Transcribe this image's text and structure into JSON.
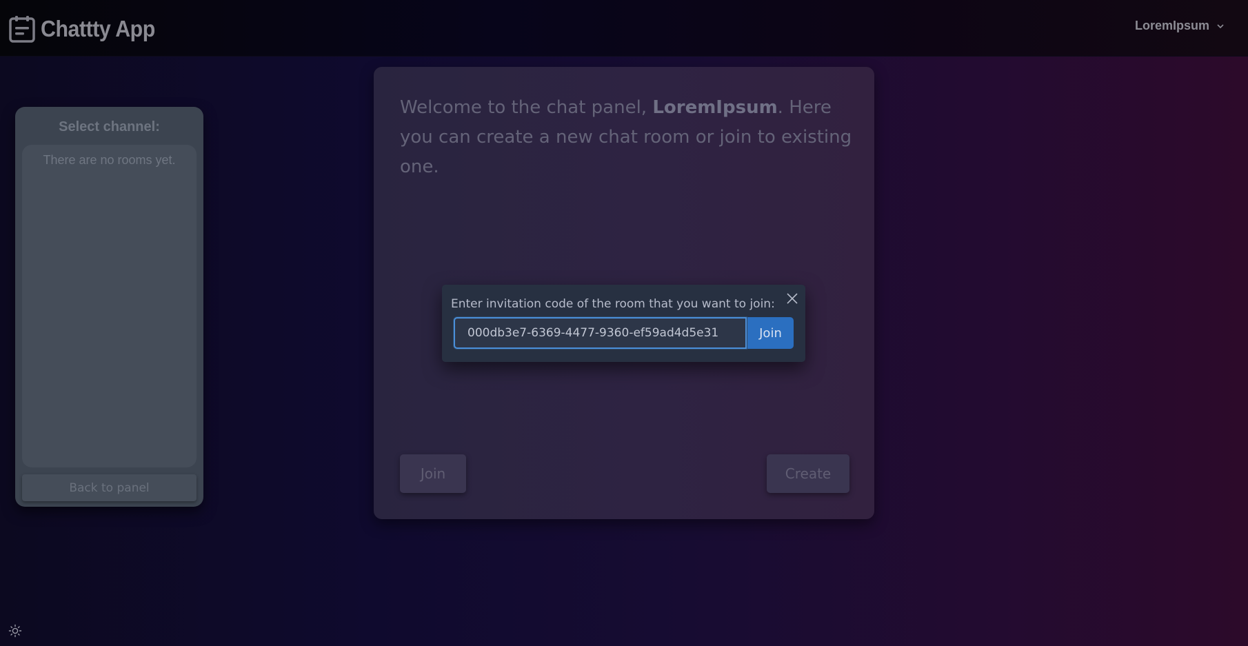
{
  "navbar": {
    "app_title": "Chattty App",
    "user_name": "LoremIpsum"
  },
  "sidebar": {
    "title": "Select channel:",
    "empty_text": "There are no rooms yet.",
    "back_label": "Back to panel"
  },
  "panel": {
    "welcome_prefix": "Welcome to the chat panel, ",
    "welcome_user": "LoremIpsum",
    "welcome_suffix": ". Here you can create a new chat room or join to existing one.",
    "join_label": "Join",
    "create_label": "Create"
  },
  "modal": {
    "label": "Enter invitation code of the room that you want to join:",
    "code_value": "000db3e7-6369-4477-9360-ef59ad4d5e31",
    "join_label": "Join"
  },
  "icons": {
    "brand": "calendar-note-icon",
    "user_menu": "chevron-down-icon",
    "close": "close-icon",
    "theme": "sun-icon"
  },
  "colors": {
    "accent": "#2b6fc0",
    "input_border": "#4a8fd9"
  }
}
